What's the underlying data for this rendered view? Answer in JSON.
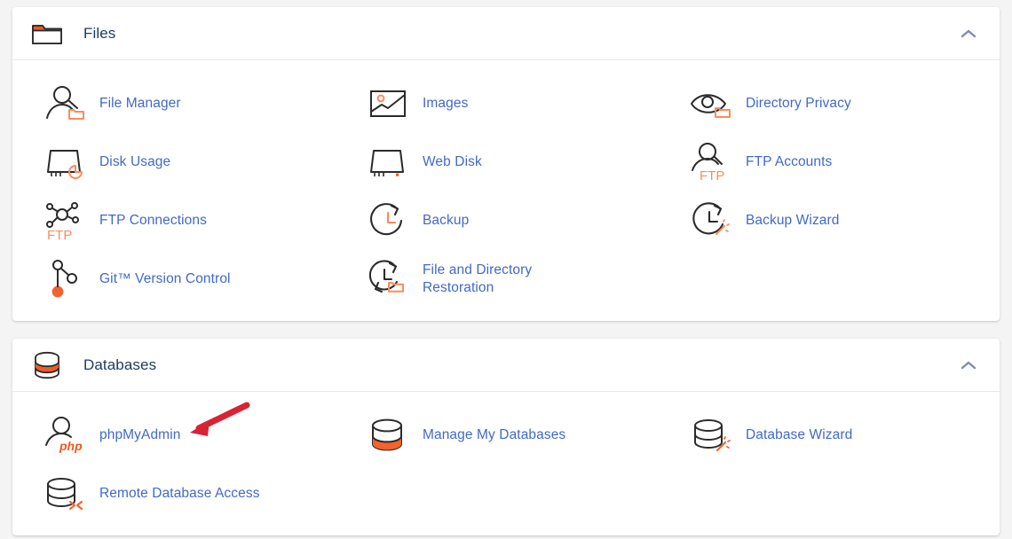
{
  "theme": {
    "page_background": "#f4f4f4",
    "card_background": "#ffffff",
    "link_color": "#4169c7",
    "heading_color": "#1c3a5e",
    "accent_color": "#ff6c2c",
    "icon_stroke": "#2b2b2b",
    "annotation_color": "#d92233",
    "divider_color": "#e3e8f0"
  },
  "sections": [
    {
      "title": "Files",
      "header_icon": "folder-icon",
      "collapse_icon": "chevron-up-icon",
      "collapse_label": "Collapse",
      "items": [
        {
          "label": "File Manager",
          "icon": "file-manager-icon"
        },
        {
          "label": "Images",
          "icon": "images-icon"
        },
        {
          "label": "Directory Privacy",
          "icon": "directory-privacy-icon"
        },
        {
          "label": "Disk Usage",
          "icon": "disk-usage-icon"
        },
        {
          "label": "Web Disk",
          "icon": "web-disk-icon"
        },
        {
          "label": "FTP Accounts",
          "icon": "ftp-accounts-icon"
        },
        {
          "label": "FTP Connections",
          "icon": "ftp-connections-icon"
        },
        {
          "label": "Backup",
          "icon": "backup-icon"
        },
        {
          "label": "Backup Wizard",
          "icon": "backup-wizard-icon"
        },
        {
          "label": "Git™ Version Control",
          "icon": "git-version-control-icon"
        },
        {
          "label": "File and Directory Restoration",
          "icon": "file-directory-restoration-icon"
        }
      ]
    },
    {
      "title": "Databases",
      "header_icon": "database-icon",
      "collapse_icon": "chevron-up-icon",
      "collapse_label": "Collapse",
      "items": [
        {
          "label": "phpMyAdmin",
          "icon": "phpmyadmin-icon"
        },
        {
          "label": "Manage My Databases",
          "icon": "manage-databases-icon"
        },
        {
          "label": "Database Wizard",
          "icon": "database-wizard-icon"
        },
        {
          "label": "Remote Database Access",
          "icon": "remote-database-access-icon"
        }
      ]
    }
  ],
  "annotation": {
    "type": "arrow",
    "points_to": "phpMyAdmin",
    "color": "#d92233"
  }
}
